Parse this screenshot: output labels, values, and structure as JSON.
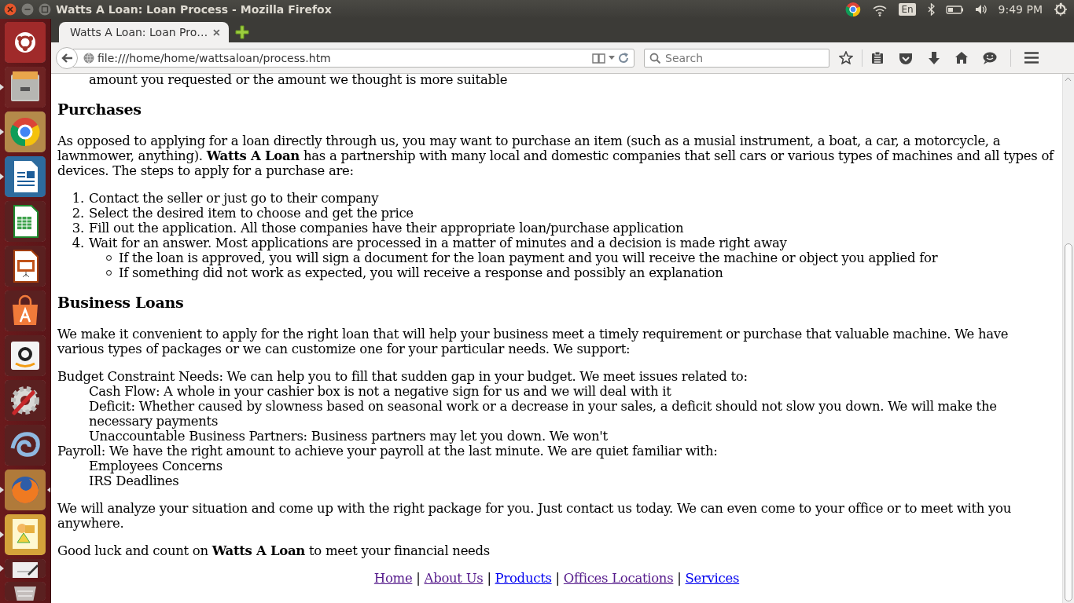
{
  "top_bar": {
    "title": "Watts A Loan: Loan Process - Mozilla Firefox",
    "keyboard_layout": "En",
    "clock": "9:49 PM"
  },
  "launcher": {
    "items": [
      {
        "kind": "dash",
        "running": false,
        "focused": false
      },
      {
        "kind": "files",
        "running": true,
        "focused": false
      },
      {
        "kind": "chrome",
        "running": true,
        "focused": false
      },
      {
        "kind": "writer",
        "running": true,
        "focused": false
      },
      {
        "kind": "calc",
        "running": false,
        "focused": false
      },
      {
        "kind": "impress",
        "running": false,
        "focused": false
      },
      {
        "kind": "store",
        "running": false,
        "focused": false
      },
      {
        "kind": "amazon",
        "running": false,
        "focused": false
      },
      {
        "kind": "settings",
        "running": false,
        "focused": false
      },
      {
        "kind": "spiral",
        "running": false,
        "focused": false
      },
      {
        "kind": "firefox",
        "running": true,
        "focused": true
      },
      {
        "kind": "draw",
        "running": true,
        "focused": false
      },
      {
        "kind": "editor",
        "running": true,
        "focused": false
      },
      {
        "kind": "trash",
        "running": false,
        "focused": false
      }
    ]
  },
  "tabs": [
    {
      "label": "Watts A Loan: Loan Pro…",
      "selected": true
    }
  ],
  "address_bar": {
    "value": "file:///home/home/wattsaloan/process.htm"
  },
  "search": {
    "placeholder": "Search"
  },
  "page": {
    "blocks": [
      {
        "kind": "continuation",
        "text": "amount you requested or the amount we thought is more suitable"
      },
      {
        "kind": "heading",
        "text": "Purchases"
      },
      {
        "kind": "paragraph",
        "text": "As opposed to applying for a loan directly through us, you may want to purchase an item (such as a musial instrument, a boat, a car, a motorcycle, a lawnmower, anything). **Watts A Loan** has a partnership with many local and domestic companies that sell cars or various types of machines and all types of devices. The steps to apply for a purchase are:"
      },
      {
        "kind": "numbered_list",
        "items": [
          {
            "marker": "1.",
            "text": "Contact the seller or just go to their company"
          },
          {
            "marker": "2.",
            "text": "Select the desired item to choose and get the price"
          },
          {
            "marker": "3.",
            "text": "Fill out the application. All those companies have their appropriate loan/purchase application"
          },
          {
            "marker": "4.",
            "text": "Wait for an answer. Most applications are processed in a matter of minutes and a decision is made right away",
            "children": [
              {
                "text": "If the loan is approved, you will sign a document for the loan payment and you will receive the machine or object you applied for"
              },
              {
                "text": "If something did not work as expected, you will receive a response and possibly an explanation"
              }
            ]
          }
        ]
      },
      {
        "kind": "heading",
        "text": "Business Loans"
      },
      {
        "kind": "paragraph",
        "text": "We make it convenient to apply for the right loan that will help your business meet a timely requirement or purchase that valuable machine. We have various types of packages or we can customize one for your particular needs. We support:"
      },
      {
        "kind": "definitions",
        "entries": [
          {
            "term": "Budget Constraint Needs: We can help you to fill that sudden gap in your budget. We meet issues related to:",
            "details": [
              "Cash Flow: A whole in your cashier box is not a negative sign for us and we will deal with it",
              "Deficit: Whether caused by slowness based on seasonal work or a decrease in your sales, a deficit should not slow you down. We will make the necessary payments",
              "Unaccountable Business Partners: Business partners may let you down. We won't"
            ]
          },
          {
            "term": "Payroll: We have the right amount to achieve your payroll at the last minute. We are quiet familiar with:",
            "details": [
              "Employees Concerns",
              "IRS Deadlines"
            ]
          }
        ]
      },
      {
        "kind": "paragraph",
        "text": "We will analyze your situation and come up with the right package for you. Just contact us today. We can even come to your office or to meet with you anywhere."
      },
      {
        "kind": "paragraph",
        "text": "Good luck and count on **Watts A Loan** to meet your financial needs"
      }
    ],
    "footer_links": [
      {
        "label": "Home",
        "visited": true,
        "separator": "|"
      },
      {
        "label": "About Us",
        "visited": true,
        "separator": "|"
      },
      {
        "label": "Products",
        "visited": false,
        "separator": "|"
      },
      {
        "label": "Offices Locations",
        "visited": true,
        "separator": "|"
      },
      {
        "label": "Services",
        "visited": false
      }
    ]
  }
}
